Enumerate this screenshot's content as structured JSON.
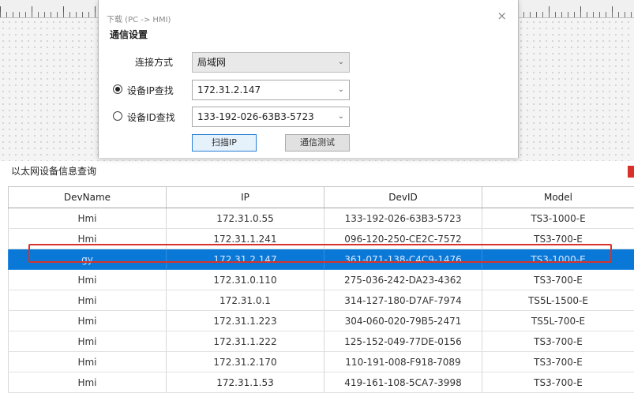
{
  "dialog": {
    "title": "下载 (PC -> HMI)",
    "close_symbol": "×",
    "section_title": "通信设置",
    "connection_label": "连接方式",
    "connection_value": "局域网",
    "ip_search_label": "设备IP查找",
    "ip_search_value": "172.31.2.147",
    "ip_search_checked": true,
    "id_search_label": "设备ID查找",
    "id_search_value": "133-192-026-63B3-5723",
    "id_search_checked": false,
    "scan_button": "扫描IP",
    "test_button": "通信测试"
  },
  "query": {
    "title": "以太网设备信息查询"
  },
  "table": {
    "columns": [
      "DevName",
      "IP",
      "DevID",
      "Model"
    ],
    "selected_index": 2,
    "rows": [
      [
        "Hmi",
        "172.31.0.55",
        "133-192-026-63B3-5723",
        "TS3-1000-E"
      ],
      [
        "Hmi",
        "172.31.1.241",
        "096-120-250-CE2C-7572",
        "TS3-700-E"
      ],
      [
        "gy",
        "172.31.2.147",
        "361-071-138-C4C9-1476",
        "TS3-1000-E"
      ],
      [
        "Hmi",
        "172.31.0.110",
        "275-036-242-DA23-4362",
        "TS3-700-E"
      ],
      [
        "Hmi",
        "172.31.0.1",
        "314-127-180-D7AF-7974",
        "TS5L-1500-E"
      ],
      [
        "Hmi",
        "172.31.1.223",
        "304-060-020-79B5-2471",
        "TS5L-700-E"
      ],
      [
        "Hmi",
        "172.31.1.222",
        "125-152-049-77DE-0156",
        "TS3-700-E"
      ],
      [
        "Hmi",
        "172.31.2.170",
        "110-191-008-F918-7089",
        "TS3-700-E"
      ],
      [
        "Hmi",
        "172.31.1.53",
        "419-161-108-5CA7-3998",
        "TS3-700-E"
      ]
    ]
  },
  "colors": {
    "selection": "#0a78d7",
    "highlight_outline": "#d8332b",
    "primary_button_border": "#2b7fd6"
  },
  "icons": {
    "dropdown": "chevron-down-icon",
    "close": "close-icon"
  }
}
